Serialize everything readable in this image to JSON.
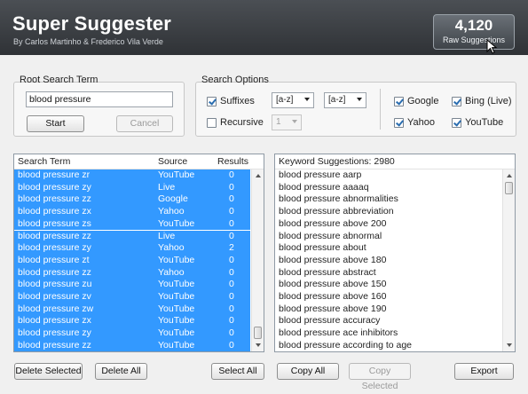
{
  "app": {
    "title": "Super Suggester",
    "subtitle": "By Carlos Martinho & Frederico Vila Verde",
    "count_value": "4,120",
    "count_label": "Raw Suggestions"
  },
  "root_search": {
    "title": "Root Search Term",
    "value": "blood pressure",
    "start_label": "Start",
    "cancel_label": "Cancel"
  },
  "search_options": {
    "title": "Search Options",
    "suffixes_label": "Suffixes",
    "suffixes_checked": true,
    "recursive_label": "Recursive",
    "recursive_checked": false,
    "range_from": "[a-z]",
    "range_to": "[a-z]",
    "depth": "1",
    "engines": [
      {
        "label": "Google",
        "checked": true
      },
      {
        "label": "Bing (Live)",
        "checked": true
      },
      {
        "label": "Yahoo",
        "checked": true
      },
      {
        "label": "YouTube",
        "checked": true
      }
    ]
  },
  "results_table": {
    "headers": [
      "Search Term",
      "Source",
      "Results"
    ],
    "rows": [
      [
        "blood pressure zr",
        "YouTube",
        "0"
      ],
      [
        "blood pressure zy",
        "Live",
        "0"
      ],
      [
        "blood pressure zz",
        "Google",
        "0"
      ],
      [
        "blood pressure zx",
        "Yahoo",
        "0"
      ],
      [
        "blood pressure zs",
        "YouTube",
        "0"
      ],
      [
        "blood pressure zz",
        "Live",
        "0"
      ],
      [
        "blood pressure zy",
        "Yahoo",
        "2"
      ],
      [
        "blood pressure zt",
        "YouTube",
        "0"
      ],
      [
        "blood pressure zz",
        "Yahoo",
        "0"
      ],
      [
        "blood pressure zu",
        "YouTube",
        "0"
      ],
      [
        "blood pressure zv",
        "YouTube",
        "0"
      ],
      [
        "blood pressure zw",
        "YouTube",
        "0"
      ],
      [
        "blood pressure zx",
        "YouTube",
        "0"
      ],
      [
        "blood pressure zy",
        "YouTube",
        "0"
      ],
      [
        "blood pressure zz",
        "YouTube",
        "0"
      ]
    ]
  },
  "keyword_list": {
    "header": "Keyword Suggestions: 2980",
    "items": [
      "blood pressure aarp",
      "blood pressure aaaaq",
      "blood pressure abnormalities",
      "blood pressure abbreviation",
      "blood pressure above 200",
      "blood pressure abnormal",
      "blood pressure about",
      "blood pressure above 180",
      "blood pressure abstract",
      "blood pressure above 150",
      "blood pressure above 160",
      "blood pressure above 190",
      "blood pressure accuracy",
      "blood pressure ace inhibitors",
      "blood pressure according to age"
    ]
  },
  "bottom_buttons": {
    "delete_selected": "Delete Selected",
    "delete_all": "Delete All",
    "select_all": "Select All",
    "copy_all": "Copy All",
    "copy_selected": "Copy Selected",
    "export": "Export"
  },
  "colors": {
    "selection": "#3399ff",
    "header_dark": "#2f3236",
    "accent_check": "#2a6db0"
  },
  "icons": {
    "cursor": "pointer-cursor-icon",
    "scroll_up": "scroll-up-arrow-icon",
    "scroll_down": "scroll-down-arrow-icon",
    "dropdown": "chevron-down-icon"
  }
}
